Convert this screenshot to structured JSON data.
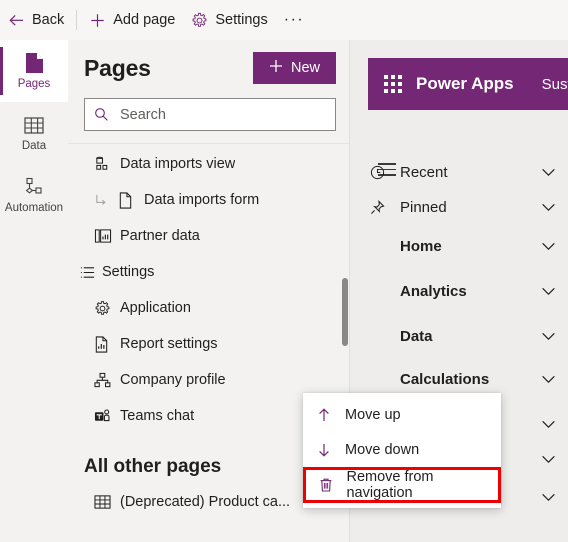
{
  "commandbar": {
    "items": [
      {
        "label": "Back",
        "icon": "arrow-left-icon"
      },
      {
        "label": "Add page",
        "icon": "plus-icon"
      },
      {
        "label": "Settings",
        "icon": "gear-icon"
      }
    ],
    "overflow": "···"
  },
  "rail": {
    "items": [
      {
        "label": "Pages",
        "icon": "page-icon",
        "selected": true
      },
      {
        "label": "Data",
        "icon": "table-icon",
        "selected": false
      },
      {
        "label": "Automation",
        "icon": "flow-icon",
        "selected": false
      }
    ]
  },
  "pages_panel": {
    "title": "Pages",
    "new_button": "New",
    "new_icon": "plus-icon",
    "search": {
      "placeholder": "Search",
      "value": "",
      "icon": "search-icon"
    },
    "items": [
      {
        "label": "Data imports view",
        "icon": "view-icon",
        "type": "row"
      },
      {
        "label": "Data imports form",
        "icon": "form-icon",
        "type": "child"
      },
      {
        "label": "Partner data",
        "icon": "dashboard-icon",
        "type": "row"
      },
      {
        "label": "Settings",
        "icon": "group-icon",
        "type": "group"
      },
      {
        "label": "Application",
        "icon": "gear-icon",
        "type": "row"
      },
      {
        "label": "Report settings",
        "icon": "report-icon",
        "type": "row"
      },
      {
        "label": "Company profile",
        "icon": "sitemap-icon",
        "type": "row",
        "active": true
      },
      {
        "label": "Teams chat",
        "icon": "teams-icon",
        "type": "row"
      }
    ],
    "section_title": "All other pages",
    "other_items": [
      {
        "label": "(Deprecated) Product ca...",
        "icon": "table-icon"
      }
    ],
    "more_button": "more-options"
  },
  "context_menu": {
    "items": [
      {
        "label": "Move up",
        "icon": "arrow-up-icon",
        "highlighted": false
      },
      {
        "label": "Move down",
        "icon": "arrow-down-icon",
        "highlighted": false
      },
      {
        "label": "Remove from navigation",
        "icon": "trash-icon",
        "highlighted": true
      }
    ]
  },
  "preview": {
    "app_header": {
      "waffle": "app-launcher-icon",
      "product": "Power Apps",
      "app_name": "Susta"
    },
    "hamburger": "hamburger-icon",
    "nav": [
      {
        "label": "Recent",
        "icon": "clock-icon",
        "bold": false,
        "chevron": true
      },
      {
        "label": "Pinned",
        "icon": "pin-icon",
        "bold": false,
        "chevron": true
      },
      {
        "label": "Home",
        "icon": "",
        "bold": true,
        "chevron": true
      },
      {
        "label": "Analytics",
        "icon": "",
        "bold": true,
        "chevron": true
      },
      {
        "label": "Data",
        "icon": "",
        "bold": true,
        "chevron": true
      },
      {
        "label": "Calculations",
        "icon": "",
        "bold": true,
        "chevron": true
      },
      {
        "label": "",
        "icon": "",
        "bold": true,
        "chevron": true
      },
      {
        "label": "",
        "icon": "",
        "bold": true,
        "chevron": true
      },
      {
        "label": "",
        "icon": "",
        "bold": true,
        "chevron": true
      }
    ]
  },
  "colors": {
    "brand_purple": "#742774",
    "highlight_red": "#ee0000",
    "panel_bg": "#f3f2f1",
    "preview_bg": "#eeedec"
  }
}
